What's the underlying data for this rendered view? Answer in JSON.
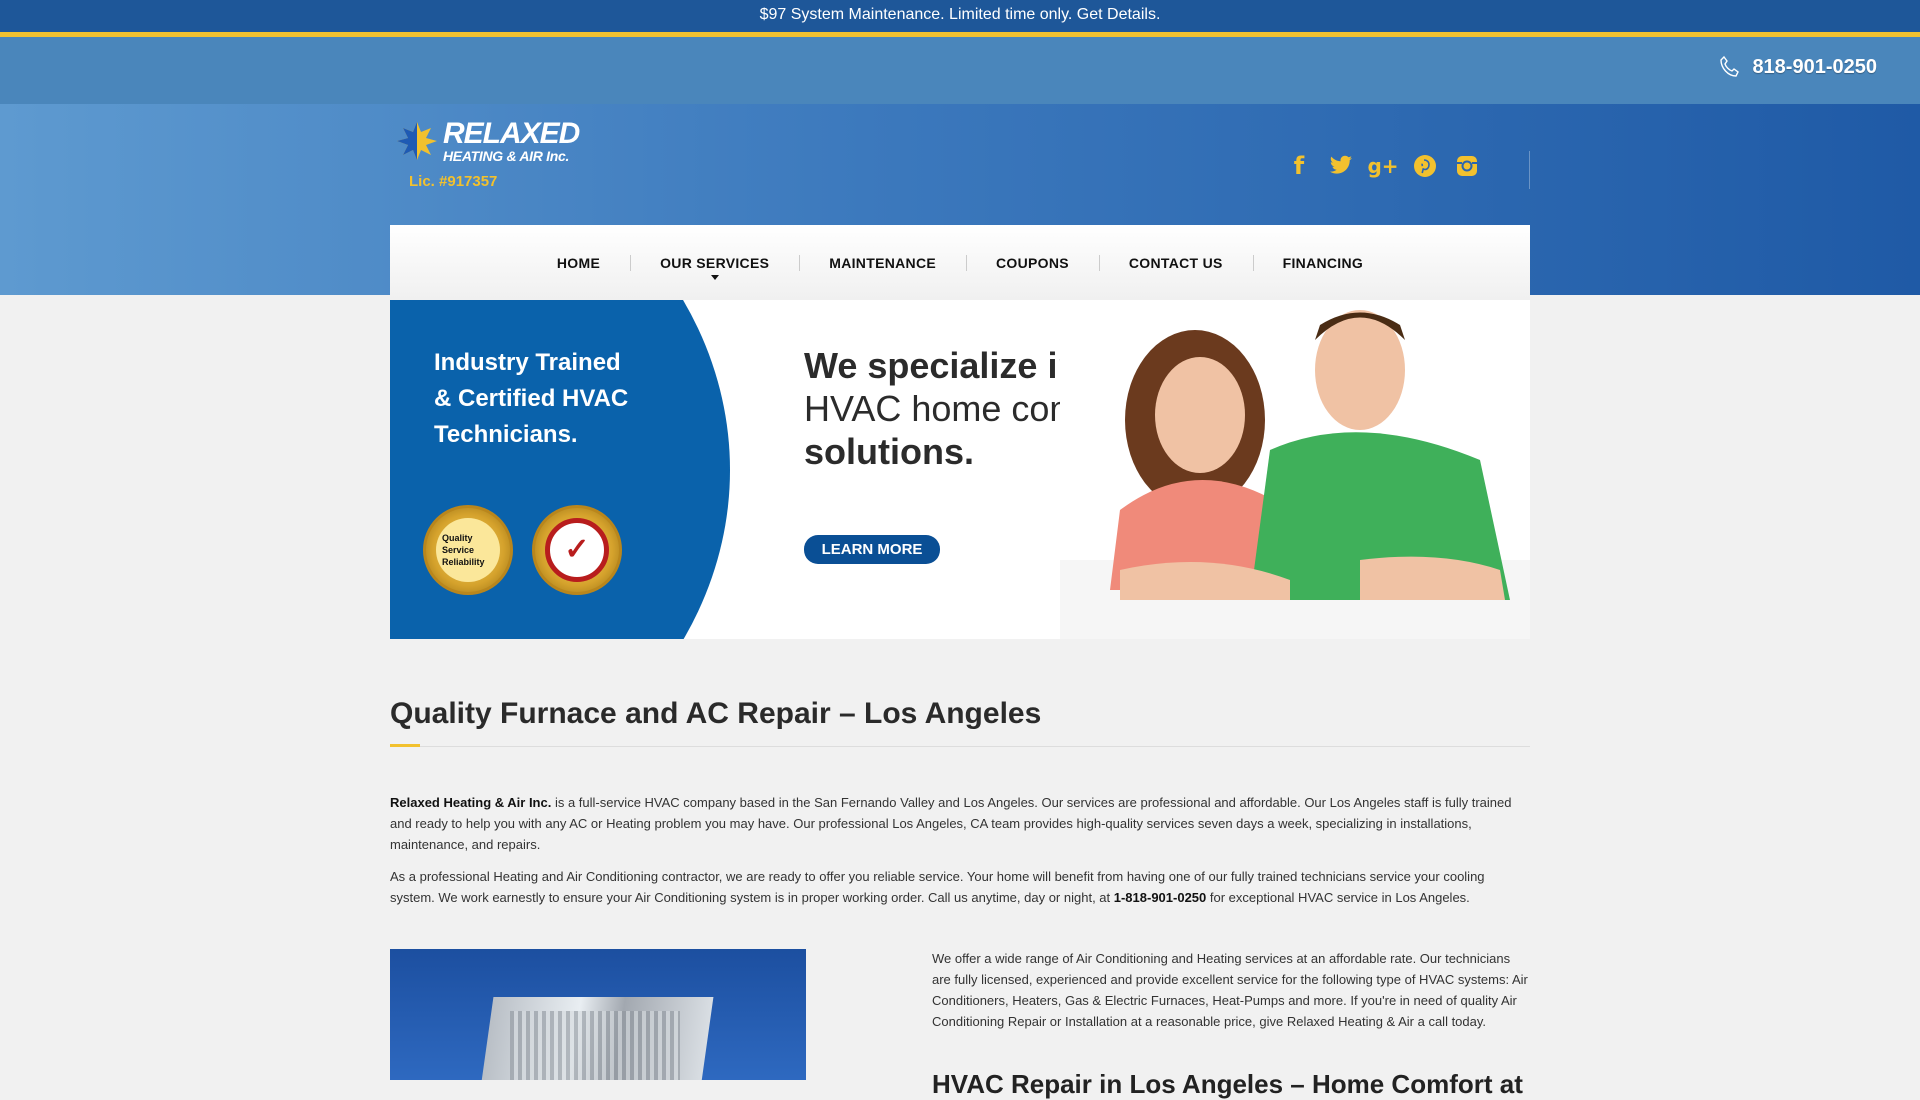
{
  "promo": {
    "text": "$97 System Maintenance. Limited time only. Get Details."
  },
  "header": {
    "phone": "818-901-0250",
    "logo_title": "RELAXED",
    "logo_subtitle": "HEATING & AIR Inc.",
    "license": "Lic. #917357",
    "social_icons": [
      "facebook-icon",
      "twitter-icon",
      "google-plus-icon",
      "pinterest-icon",
      "instagram-icon"
    ]
  },
  "nav": {
    "items": [
      {
        "label": "HOME"
      },
      {
        "label": "OUR SERVICES"
      },
      {
        "label": "MAINTENANCE"
      },
      {
        "label": "COUPONS"
      },
      {
        "label": "CONTACT US"
      },
      {
        "label": "FINANCING"
      }
    ]
  },
  "banner": {
    "tagline_1": "Industry Trained",
    "tagline_2": "& Certified HVAC",
    "tagline_3": "Technicians.",
    "seal1_lines": [
      "Quality",
      "Service",
      "Reliability"
    ],
    "headline_1": "We specialize in",
    "headline_2": "HVAC home comfort",
    "headline_3": "solutions.",
    "cta": "LEARN MORE"
  },
  "content": {
    "title": "Quality Furnace and AC Repair – Los Angeles",
    "p1_bold": "Relaxed Heating & Air Inc.",
    "p1_rest": " is a full-service HVAC company based in the San Fernando Valley and Los Angeles. Our services are professional and affordable. Our Los Angeles staff is fully trained and ready to help you with any AC or Heating problem you may have. Our professional Los Angeles, CA team provides high-quality services seven days a week, specializing in installations, maintenance, and repairs.",
    "p2_start": "As a professional Heating and Air Conditioning contractor, we are ready to offer you reliable service. Your home will benefit from having one of our fully trained technicians service your cooling system. We work earnestly to ensure your Air Conditioning system is in proper working order. Call us anytime, day or night, at ",
    "p2_phone": "1-818-901-0250",
    "p2_end": " for exceptional HVAC service in Los Angeles.",
    "p3": "We offer a wide range of Air Conditioning and Heating services at an affordable rate.  Our technicians are fully licensed, experienced and provide excellent service for the following type of HVAC systems: Air Conditioners, Heaters, Gas & Electric Furnaces, Heat-Pumps and more. If you're in need of quality Air Conditioning Repair or Installation at a reasonable price, give Relaxed Heating & Air a call today.",
    "h2_partial": "HVAC Repair in Los Angeles – Home Comfort at"
  },
  "colors": {
    "brand_blue": "#1e5799",
    "accent_yellow": "#f2c12e",
    "banner_blue": "#0a62ab"
  }
}
